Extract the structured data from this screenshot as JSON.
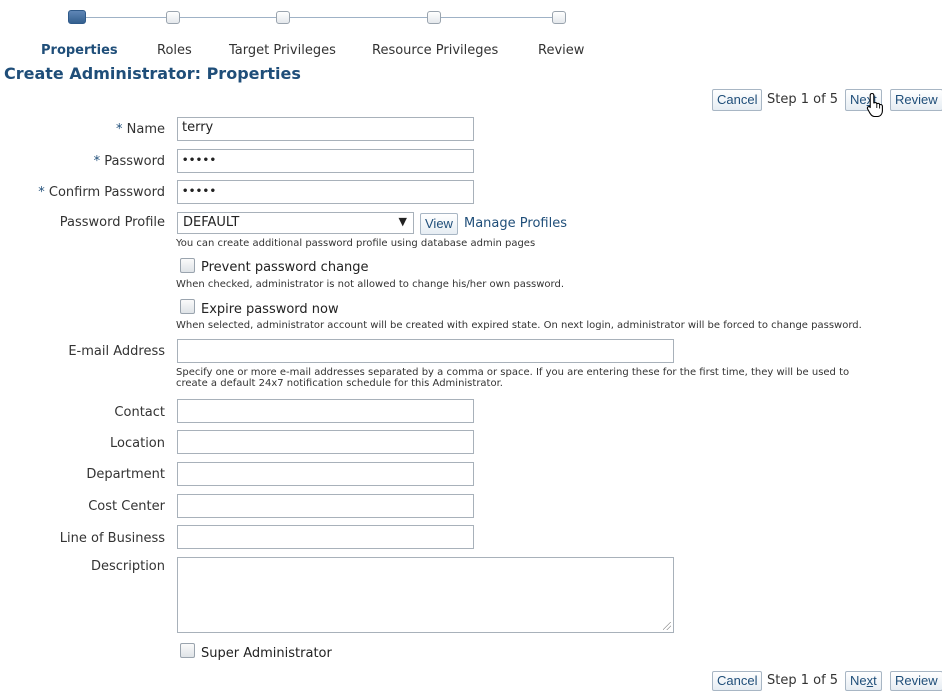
{
  "train": {
    "steps": [
      {
        "label": "Properties",
        "active": true
      },
      {
        "label": "Roles",
        "active": false
      },
      {
        "label": "Target Privileges",
        "active": false
      },
      {
        "label": "Resource Privileges",
        "active": false
      },
      {
        "label": "Review",
        "active": false
      }
    ]
  },
  "page_title": "Create Administrator: Properties",
  "nav": {
    "cancel": "Cancel",
    "step_text": "Step 1 of 5",
    "next_pre": "Ne",
    "next_mn": "x",
    "next_post": "t",
    "review": "Review"
  },
  "form": {
    "required_mark": "*",
    "name_label": "Name",
    "name_value": "terry",
    "password_label": "Password",
    "password_value": "•••••",
    "confirm_label": "Confirm Password",
    "confirm_value": "•••••",
    "profile_label": "Password Profile",
    "profile_value": "DEFAULT",
    "profile_arrow": "▼",
    "view_button": "View",
    "manage_profiles_link": "Manage Profiles",
    "profile_hint": "You can create additional password profile using database admin pages",
    "prevent_change_label": "Prevent password change",
    "prevent_change_hint": "When checked, administrator is not allowed to change his/her own password.",
    "expire_label": "Expire password now",
    "expire_hint": "When selected, administrator account will be created with expired state. On next login, administrator will be forced to change password.",
    "email_label": "E-mail Address",
    "email_value": "",
    "email_hint_line1": "Specify one or more e-mail addresses separated by a comma or space. If you are entering these for the first time, they will be used to",
    "email_hint_line2": "create a default 24x7 notification schedule for this Administrator.",
    "contact_label": "Contact",
    "location_label": "Location",
    "department_label": "Department",
    "cost_center_label": "Cost Center",
    "lob_label": "Line of Business",
    "description_label": "Description",
    "super_admin_label": "Super Administrator"
  },
  "colors": {
    "accent": "#1f4e79",
    "train_active": "#34608f",
    "border": "#a8b1ba"
  },
  "icons": {
    "cursor": "pointer-hand-icon",
    "dropdown": "chevron-down-icon"
  }
}
